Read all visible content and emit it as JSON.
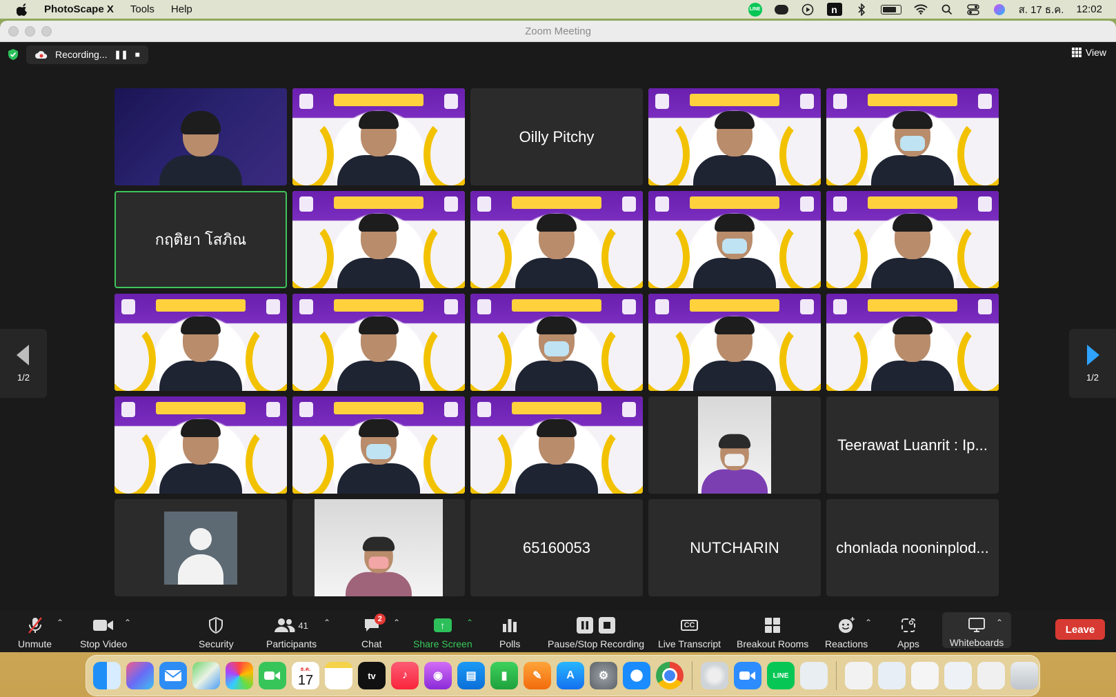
{
  "menubar": {
    "app_name": "PhotoScape X",
    "menus": [
      "Tools",
      "Help"
    ],
    "date": "ส. 17 ธ.ค.",
    "time": "12:02"
  },
  "window": {
    "title": "Zoom Meeting"
  },
  "recording": {
    "label": "Recording..."
  },
  "view_button": {
    "label": "View"
  },
  "pagination": {
    "left_label": "1/2",
    "right_label": "1/2"
  },
  "tiles": [
    {
      "kind": "video-emid"
    },
    {
      "kind": "video-purple"
    },
    {
      "kind": "name",
      "name": "Oilly Pitchy"
    },
    {
      "kind": "video-purple"
    },
    {
      "kind": "video-purple"
    },
    {
      "kind": "name",
      "name": "กฤติยา โสภิณ",
      "active_speaker": true
    },
    {
      "kind": "video-purple"
    },
    {
      "kind": "video-purple"
    },
    {
      "kind": "video-purple"
    },
    {
      "kind": "video-purple"
    },
    {
      "kind": "video-purple"
    },
    {
      "kind": "video-purple"
    },
    {
      "kind": "video-purple"
    },
    {
      "kind": "video-purple"
    },
    {
      "kind": "video-purple"
    },
    {
      "kind": "video-purple"
    },
    {
      "kind": "video-purple"
    },
    {
      "kind": "video-purple"
    },
    {
      "kind": "video-photo"
    },
    {
      "kind": "name",
      "name": "Teerawat Luanrit : Ip..."
    },
    {
      "kind": "avatar"
    },
    {
      "kind": "video-photo"
    },
    {
      "kind": "name",
      "name": "65160053"
    },
    {
      "kind": "name",
      "name": "NUTCHARIN"
    },
    {
      "kind": "name",
      "name": "chonlada nooninplod..."
    }
  ],
  "toolbar": {
    "unmute": "Unmute",
    "stop_video": "Stop Video",
    "security": "Security",
    "participants": "Participants",
    "participants_count": "41",
    "chat": "Chat",
    "chat_badge": "2",
    "share_screen": "Share Screen",
    "polls": "Polls",
    "pause_stop_recording": "Pause/Stop Recording",
    "live_transcript": "Live Transcript",
    "live_transcript_icon": "CC",
    "breakout_rooms": "Breakout Rooms",
    "reactions": "Reactions",
    "apps": "Apps",
    "whiteboards": "Whiteboards",
    "leave": "Leave"
  },
  "dock": {
    "calendar_month": "ธ.ค.",
    "calendar_day": "17",
    "line_label": "LINE",
    "tv_label": "tv"
  },
  "colors": {
    "accent_green": "#2dc05a",
    "leave_red": "#d73a32",
    "speaker_outline": "#3ec45b",
    "purple_bg": "#6a1fae"
  }
}
